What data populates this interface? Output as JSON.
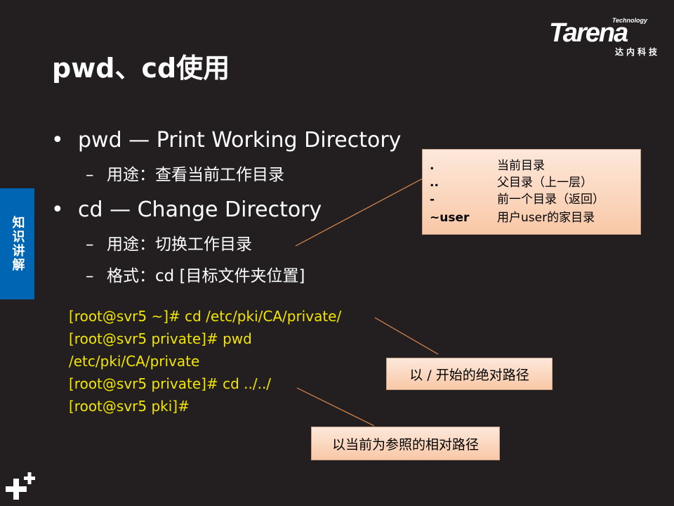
{
  "logo": {
    "technology": "Technology",
    "wordmark": "Tarena",
    "chinese": "达内科技"
  },
  "title": "pwd、cd使用",
  "side_tab": "知识讲解",
  "bullets": [
    {
      "text": "pwd — Print Working Directory",
      "subs": [
        "用途：查看当前工作目录"
      ]
    },
    {
      "text": "cd — Change Directory",
      "subs": [
        "用途：切换工作目录",
        "格式：cd  [目标文件夹位置]"
      ]
    }
  ],
  "bullet_symbol": "•",
  "dash_symbol": "–",
  "terminal": {
    "lines": [
      "[root@svr5 ~]# cd  /etc/pki/CA/private/",
      "[root@svr5 private]#  pwd",
      "/etc/pki/CA/private",
      "[root@svr5 private]# cd  ../../",
      "[root@svr5 pki]#"
    ]
  },
  "reference": [
    {
      "symbol": ".",
      "desc": "当前目录"
    },
    {
      "symbol": "..",
      "desc": "父目录（上一层）"
    },
    {
      "symbol": "-",
      "desc": "前一个目录（返回）"
    },
    {
      "symbol": "~user",
      "desc": "用户user的家目录"
    }
  ],
  "callouts": {
    "absolute": "以 / 开始的绝对路径",
    "relative": "以当前为参照的相对路径"
  },
  "colors": {
    "background": "#231f20",
    "side_tab": "#0066b3",
    "terminal_text": "#f2e600",
    "callout_fill": "#fbd5bd"
  },
  "icons": {
    "corner": "plus-icon"
  }
}
